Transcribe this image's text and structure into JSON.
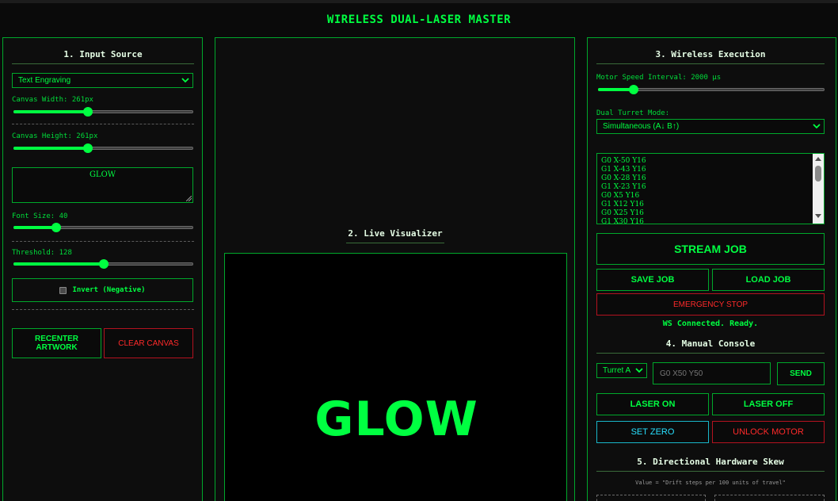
{
  "app": {
    "title": "WIRELESS DUAL-LASER MASTER"
  },
  "input": {
    "title": "1. Input Source",
    "mode": "Text Engraving",
    "canvas_width_label": "Canvas Width: 261px",
    "canvas_width_level": 0.41,
    "canvas_height_label": "Canvas Height: 261px",
    "canvas_height_level": 0.41,
    "text_value": "GLOW",
    "font_size_label": "Font Size: 40",
    "font_size_level": 0.23,
    "threshold_label": "Threshold: 128",
    "threshold_level": 0.5,
    "invert_label": "Invert (Negative)",
    "invert_checked": false,
    "recenter_label": "RECENTER ARTWORK",
    "clear_label": "CLEAR CANVAS"
  },
  "visualizer": {
    "title": "2. Live Visualizer",
    "preview_text": "GLOW"
  },
  "execution": {
    "title": "3. Wireless Execution",
    "speed_label": "Motor Speed Interval: 2000 µs",
    "speed_level": 0.15,
    "turret_mode_label": "Dual Turret Mode:",
    "turret_mode": "Simultaneous (A↓ B↑)",
    "gcode_lines": [
      "G0 X-50 Y16",
      "G1 X-43 Y16",
      "G0 X-28 Y16",
      "G1 X-23 Y16",
      "G0 X5 Y16",
      "G1 X12 Y16",
      "G0 X25 Y16",
      "G1 X30 Y16"
    ],
    "stream_label": "STREAM JOB",
    "save_label": "SAVE JOB",
    "load_label": "LOAD JOB",
    "estop_label": "EMERGENCY STOP",
    "status": "WS Connected. Ready."
  },
  "manual": {
    "title": "4. Manual Console",
    "turret": "Turret A",
    "command_placeholder": "G0 X50 Y50",
    "send_label": "SEND",
    "laser_on_label": "LASER ON",
    "laser_off_label": "LASER OFF",
    "set_zero_label": "SET ZERO",
    "unlock_label": "UNLOCK MOTOR"
  },
  "skew": {
    "title": "5. Directional Hardware Skew",
    "note": "Value = \"Drift steps per 100 units of travel\""
  },
  "colors": {
    "accent": "#00ff41",
    "border": "#00a82b",
    "danger": "#ff2a2a",
    "info": "#28e0ff",
    "background": "#0a0a0a"
  }
}
